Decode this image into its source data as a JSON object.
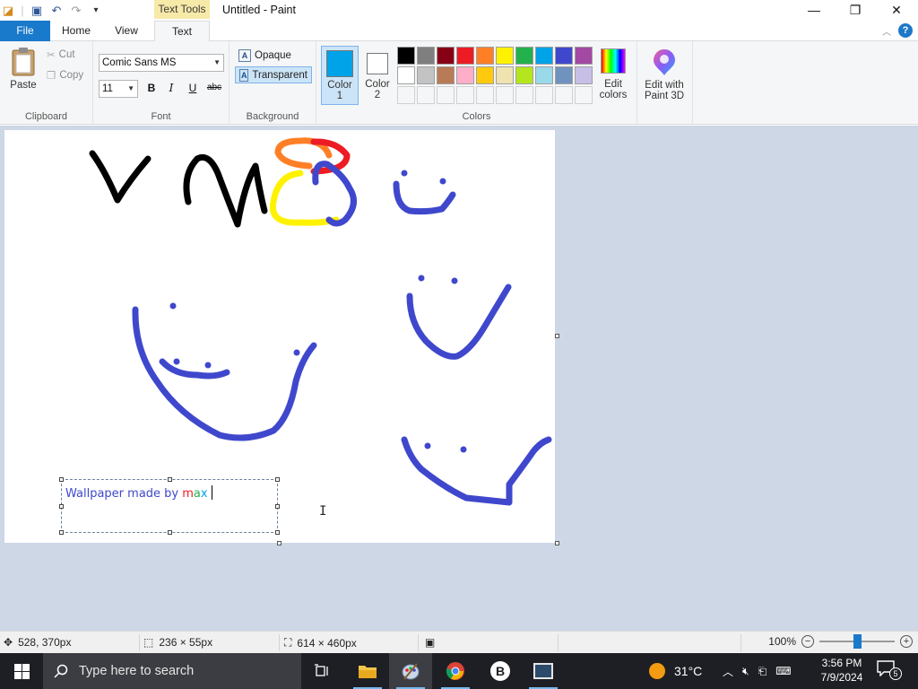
{
  "window": {
    "title": "Untitled - Paint",
    "context_tab": "Text Tools"
  },
  "tabs": [
    {
      "label": "File"
    },
    {
      "label": "Home"
    },
    {
      "label": "View"
    },
    {
      "label": "Text"
    }
  ],
  "clipboard": {
    "paste": "Paste",
    "cut": "Cut",
    "copy": "Copy",
    "group_label": "Clipboard"
  },
  "font": {
    "family": "Comic Sans MS",
    "size": "11",
    "bold": "B",
    "italic": "I",
    "underline": "U",
    "strikethrough": "abc",
    "group_label": "Font"
  },
  "background": {
    "opaque": "Opaque",
    "transparent": "Transparent",
    "selected": "Transparent",
    "group_label": "Background"
  },
  "colors": {
    "color1_label": "Color",
    "color1_num": "1",
    "color1_value": "#00a2e8",
    "color2_label": "Color",
    "color2_num": "2",
    "color2_value": "#ffffff",
    "edit_colors_l1": "Edit",
    "edit_colors_l2": "colors",
    "group_label": "Colors",
    "palette_row1": [
      "#000000",
      "#7f7f7f",
      "#880015",
      "#ed1c24",
      "#ff7f27",
      "#fff200",
      "#22b14c",
      "#00a2e8",
      "#3f48cc",
      "#a349a4"
    ],
    "palette_row2": [
      "#ffffff",
      "#c3c3c3",
      "#b97a57",
      "#ffaec9",
      "#ffc90e",
      "#efe4b0",
      "#b5e61d",
      "#99d9ea",
      "#7092be",
      "#c8bfe7"
    ]
  },
  "paint3d": {
    "l1": "Edit with",
    "l2": "Paint 3D"
  },
  "canvas": {
    "text_prefix": "Wallpaper made by ",
    "text_m": "m",
    "text_a": "a",
    "text_x": "x",
    "text_m_color": "#ed1c24",
    "text_a_color": "#22b14c",
    "text_x_color": "#00a2e8",
    "text_color": "#3f48cc"
  },
  "status": {
    "cursor_pos": "528, 370px",
    "selection_size": "236 × 55px",
    "image_size": "614 × 460px",
    "zoom": "100%",
    "zoom_level_pct": 50
  },
  "taskbar": {
    "search_placeholder": "Type here to search",
    "temperature": "31°C",
    "time": "3:56 PM",
    "date": "7/9/2024",
    "notifications": "5"
  }
}
